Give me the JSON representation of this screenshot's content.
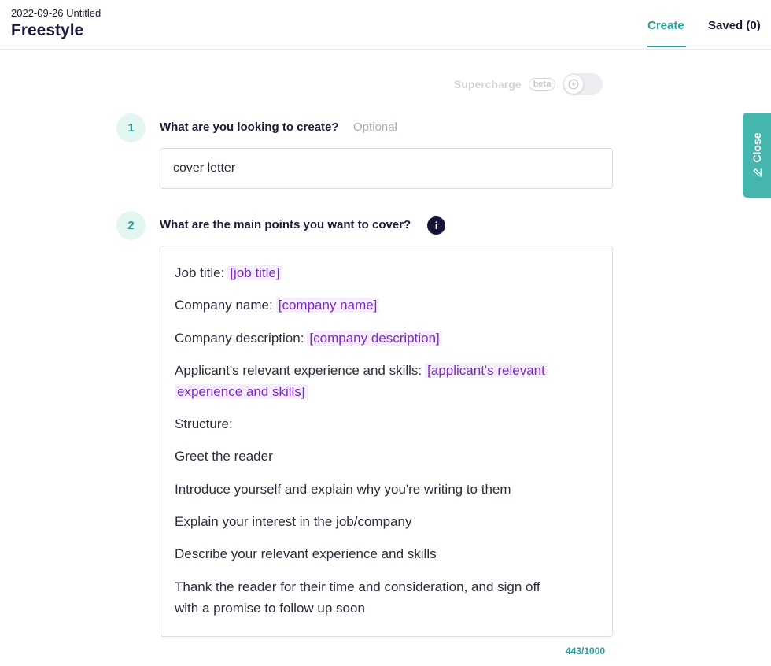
{
  "header": {
    "doc_meta": "2022-09-26 Untitled",
    "title": "Freestyle",
    "tabs": [
      {
        "label": "Create",
        "active": true
      },
      {
        "label": "Saved (0)",
        "active": false
      }
    ]
  },
  "supercharge": {
    "label": "Supercharge",
    "badge": "beta",
    "enabled": false,
    "icon": "lightning-icon"
  },
  "step1": {
    "number": "1",
    "label": "What are you looking to create?",
    "optional_label": "Optional",
    "value": "cover letter"
  },
  "step2": {
    "number": "2",
    "label": "What are the main points you want to cover?",
    "info_icon": "i",
    "lines": [
      {
        "text": "Job title:",
        "variable": "[job title]"
      },
      {
        "text": "Company name:",
        "variable": "[company name]"
      },
      {
        "text": "Company description:",
        "variable": "[company description]"
      },
      {
        "text": "Applicant's relevant experience and skills:",
        "variable_a": "[applicant's relevant",
        "variable_b": "experience and skills]"
      },
      {
        "text": "Structure:"
      },
      {
        "text": "Greet the reader"
      },
      {
        "text": "Introduce yourself and explain why you're writing to them"
      },
      {
        "text": "Explain your interest in the job/company"
      },
      {
        "text": "Describe your relevant experience and skills"
      },
      {
        "text": "Thank the reader for their time and consideration, and sign off",
        "text_b": "with a promise to follow up soon"
      }
    ],
    "counter": "443/1000"
  },
  "close_tab": {
    "label": "Close",
    "icon": "pencil-icon"
  },
  "colors": {
    "accent": "#2a9d96",
    "variable_text": "#7b2cbf",
    "variable_bg": "#f6eefd",
    "close_tab_bg": "#45b6ae"
  }
}
